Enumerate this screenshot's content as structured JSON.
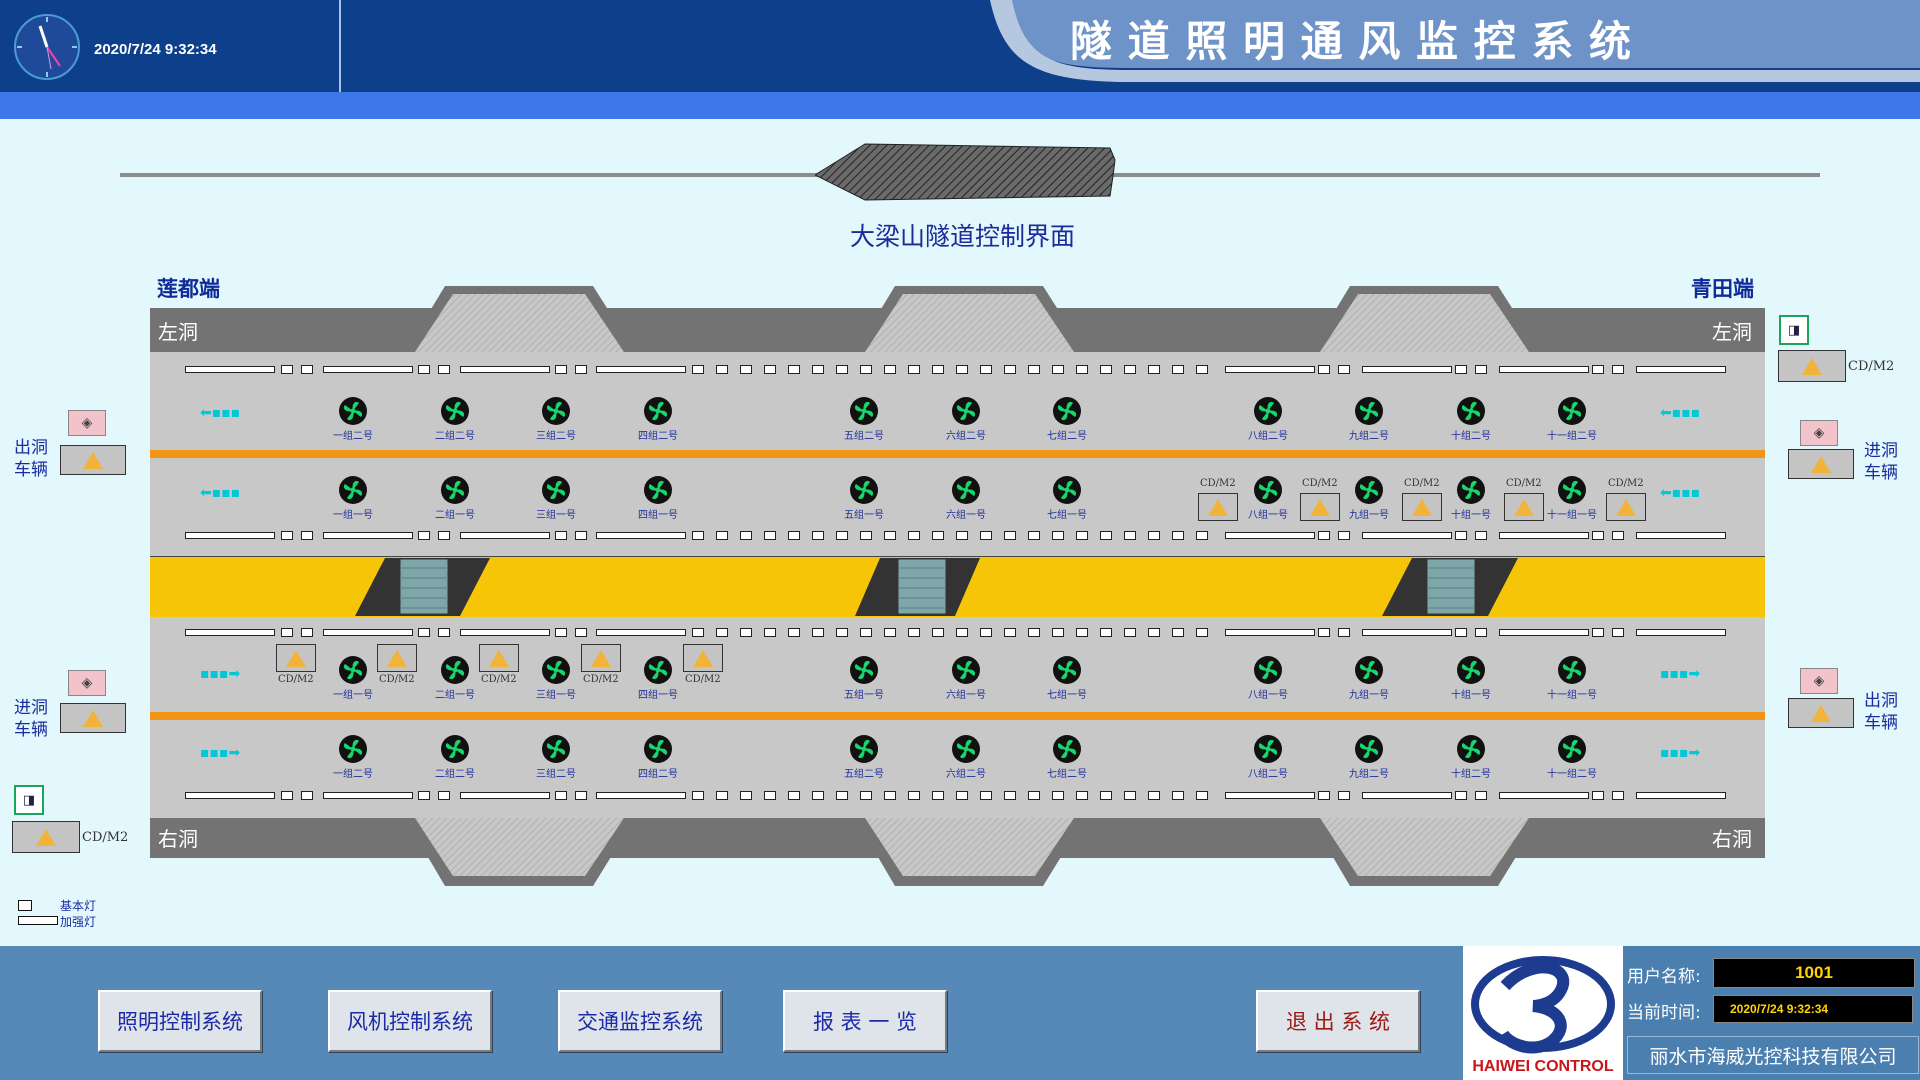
{
  "header": {
    "datetime": "2020/7/24 9:32:34",
    "system_title": "隧 道 照 明 通 风 监 控 系 统"
  },
  "main": {
    "screen_title": "大梁山隧道控制界面",
    "end_left": "莲都端",
    "end_right": "青田端",
    "left_bore": "左洞",
    "right_bore": "右洞",
    "left_exit_vehicles": "出洞\n车辆",
    "left_enter_vehicles": "进洞\n车辆",
    "right_enter_vehicles": "进洞\n车辆",
    "right_exit_vehicles": "出洞\n车辆",
    "cd_label": "CD/M2",
    "fans_row1": [
      "一组二号",
      "二组二号",
      "三组二号",
      "四组二号",
      "五组二号",
      "六组二号",
      "七组二号",
      "八组二号",
      "九组二号",
      "十组二号",
      "十一组二号"
    ],
    "fans_row2": [
      "一组一号",
      "二组一号",
      "三组一号",
      "四组一号",
      "五组一号",
      "六组一号",
      "七组一号",
      "八组一号",
      "九组一号",
      "十组一号",
      "十一组一号"
    ],
    "fans_row3": [
      "一组一号",
      "二组一号",
      "三组一号",
      "四组一号",
      "五组一号",
      "六组一号",
      "七组一号",
      "八组一号",
      "九组一号",
      "十组一号",
      "十一组一号"
    ],
    "fans_row4": [
      "一组二号",
      "二组二号",
      "三组二号",
      "四组二号",
      "五组二号",
      "六组二号",
      "七组二号",
      "八组二号",
      "九组二号",
      "十组二号",
      "十一组二号"
    ],
    "legend": {
      "basic": "基本灯",
      "enhanced": "加强灯"
    }
  },
  "footer": {
    "buttons": [
      "照明控制系统",
      "风机控制系统",
      "交通监控系统",
      "报 表 一 览",
      "退 出 系 统"
    ],
    "logo_text": "HAIWEI CONTROL",
    "user_label": "用户名称:",
    "user_value": "1001",
    "time_label": "当前时间:",
    "time_value": "2020/7/24 9:32:34",
    "company": "丽水市海威光控科技有限公司"
  },
  "colors": {
    "header": "#0d3f8a",
    "bluebar": "#3c78ea",
    "footer": "#5688b8",
    "lane": "#c8c8c8",
    "orange": "#f29416",
    "yellow": "#f6c507",
    "fan_green": "#16d46a"
  }
}
